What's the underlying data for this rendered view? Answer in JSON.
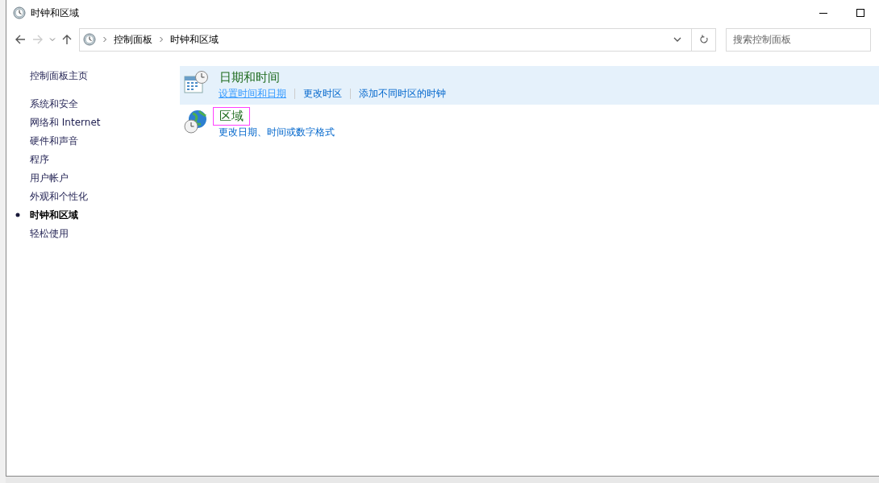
{
  "window": {
    "title": "时钟和区域"
  },
  "address_bar": {
    "breadcrumbs": [
      "控制面板",
      "时钟和区域"
    ]
  },
  "search": {
    "placeholder": "搜索控制面板"
  },
  "sidebar": {
    "home": "控制面板主页",
    "items": [
      {
        "label": "系统和安全",
        "selected": false
      },
      {
        "label": "网络和 Internet",
        "selected": false
      },
      {
        "label": "硬件和声音",
        "selected": false
      },
      {
        "label": "程序",
        "selected": false
      },
      {
        "label": "用户帐户",
        "selected": false
      },
      {
        "label": "外观和个性化",
        "selected": false
      },
      {
        "label": "时钟和区域",
        "selected": true
      },
      {
        "label": "轻松使用",
        "selected": false
      }
    ]
  },
  "categories": [
    {
      "kind": "datetime",
      "title": "日期和时间",
      "highlighted": true,
      "focused": false,
      "links": [
        {
          "label": "设置时间和日期",
          "hovered": true
        },
        {
          "label": "更改时区",
          "hovered": false
        },
        {
          "label": "添加不同时区的时钟",
          "hovered": false
        }
      ]
    },
    {
      "kind": "region",
      "title": "区域",
      "highlighted": false,
      "focused": true,
      "links": [
        {
          "label": "更改日期、时间或数字格式",
          "hovered": false
        }
      ]
    }
  ]
}
